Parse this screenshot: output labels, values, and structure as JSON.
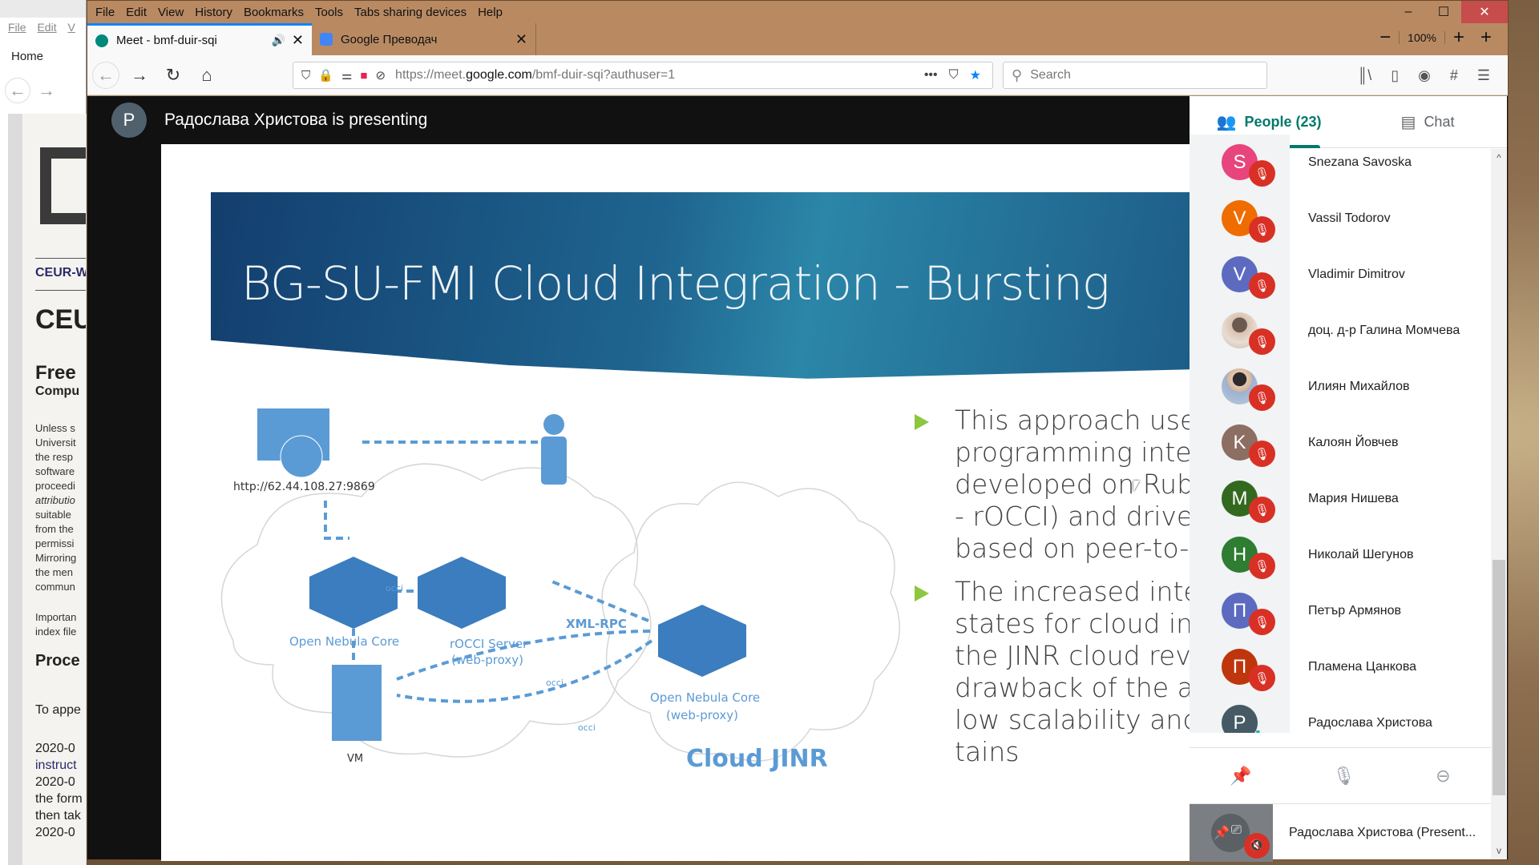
{
  "background_window": {
    "menu": [
      "File",
      "Edit",
      "V"
    ],
    "home_label": "Home",
    "link_text": "CEUR-W",
    "heading1": "CEU",
    "heading2": "Free",
    "heading3": "Compu",
    "paragraph_lines": [
      "Unless s",
      "Universit",
      "the resp",
      "software",
      "proceedi",
      "attributio",
      "suitable",
      "from the",
      "permissi",
      "Mirroring",
      "the men",
      "commun"
    ],
    "important_lines": [
      "Importan",
      "index file"
    ],
    "section_heading": "Proce",
    "red_lines": [
      "To appe",
      "2020-0",
      "instruct",
      "2020-0",
      "the form",
      "then tak",
      "2020-0"
    ]
  },
  "browser": {
    "menu": [
      "File",
      "Edit",
      "View",
      "History",
      "Bookmarks",
      "Tools",
      "Tabs sharing devices",
      "Help"
    ],
    "window_controls": {
      "minimize": "–",
      "maximize": "☐",
      "close": "✕"
    },
    "zoom": {
      "minus": "−",
      "level": "100%",
      "plus": "+",
      "add": "+"
    },
    "tabs": [
      {
        "title": "Meet - bmf-duir-sqi",
        "audio_icon": "🔊",
        "close": "✕",
        "active": true
      },
      {
        "title": "Google Преводач",
        "close": "✕",
        "active": false
      }
    ],
    "url": {
      "prefix": "https://meet.",
      "domain": "google.com",
      "path": "/bmf-duir-sqi?authuser=1"
    },
    "search_placeholder": "Search",
    "accent_color": "#0a84ff"
  },
  "meet": {
    "presenter_initial": "P",
    "presenting_text": "Радослава Христова is presenting",
    "slide": {
      "title": "BG-SU-FMI Cloud Integration - Bursting",
      "diagram": {
        "url_label": "http://62.44.108.27:9869",
        "open_nebula_core": "Open Nebula Core",
        "occi_label": "occi",
        "rocci_server": "rOCCI Server",
        "rocci_sub": "(web-proxy)",
        "xml_rpc": "XML-RPC",
        "remote_core": "Open Nebula Core",
        "remote_sub": "(web-proxy)",
        "vm": "VM",
        "cloud_jinr": "Cloud JINR",
        "occi_label2": "occi",
        "occi_label3": "occi"
      },
      "bullets": [
        {
          "lines": [
            "This approach uses",
            "programming inter",
            "developed on Rub",
            "- rOCCI) and driver",
            "based on peer-to-p"
          ]
        },
        {
          "lines": [
            "The increased inter",
            "states for cloud inte",
            "the JINR cloud reve",
            "drawback of the a",
            "low scalability and",
            "tains"
          ]
        }
      ]
    },
    "people_panel": {
      "tabs": [
        {
          "label": "People (23)",
          "icon": "people-icon",
          "active": true
        },
        {
          "label": "Chat",
          "icon": "chat-icon",
          "active": false
        }
      ],
      "participants": [
        {
          "initial": "S",
          "name": "Snezana Savoska",
          "color": "#e8457c",
          "muted": true
        },
        {
          "initial": "V",
          "name": "Vassil Todorov",
          "color": "#ef6c00",
          "muted": true
        },
        {
          "initial": "V",
          "name": "Vladimir Dimitrov",
          "color": "#5c6bc0",
          "muted": true
        },
        {
          "initial": "",
          "name": "доц. д-р Галина Момчева",
          "photo": "photo",
          "muted": true
        },
        {
          "initial": "",
          "name": "Илиян Михайлов",
          "photo": "photo2",
          "muted": true
        },
        {
          "initial": "K",
          "name": "Калоян Йовчев",
          "color": "#8d6e63",
          "muted": true
        },
        {
          "initial": "M",
          "name": "Мария Нишева",
          "color": "#33691e",
          "muted": true
        },
        {
          "initial": "H",
          "name": "Николай Шегунов",
          "color": "#2e7d32",
          "muted": true
        },
        {
          "initial": "П",
          "name": "Петър Армянов",
          "color": "#5c6bc0",
          "muted": true
        },
        {
          "initial": "П",
          "name": "Пламена Цанкова",
          "color": "#bf360c",
          "muted": true
        },
        {
          "initial": "P",
          "name": "Радослава Христова",
          "color": "#455a64",
          "muted": false,
          "speaking": true
        }
      ],
      "actions": {
        "pin": "pin-icon",
        "mic": "mic-icon",
        "remove": "remove-icon"
      },
      "presentation_tile": "Радослава Христова (Present..."
    }
  }
}
